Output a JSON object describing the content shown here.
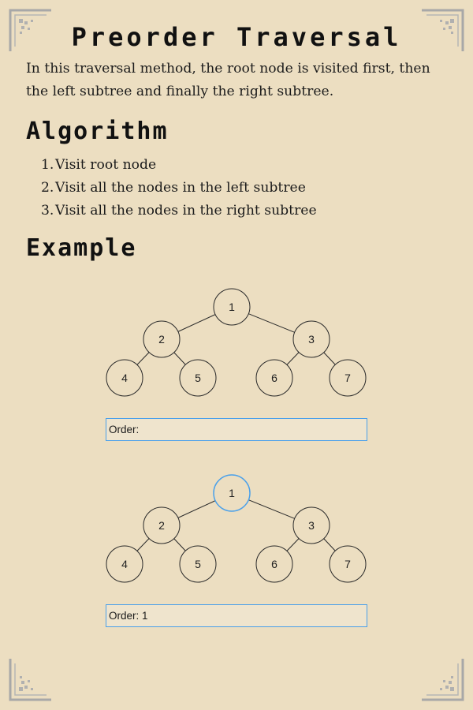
{
  "title": "Preorder Traversal",
  "intro": "In this traversal method, the root node is visited first, then the left subtree and finally the right subtree.",
  "algorithm": {
    "heading": "Algorithm",
    "steps": [
      {
        "num": "1.",
        "text": "Visit root node"
      },
      {
        "num": "2.",
        "text": "Visit all the nodes in the left subtree"
      },
      {
        "num": "3.",
        "text": "Visit all the nodes in the right subtree"
      }
    ]
  },
  "example": {
    "heading": "Example",
    "trees": [
      {
        "nodes": [
          "1",
          "2",
          "3",
          "4",
          "5",
          "6",
          "7"
        ],
        "highlighted": null,
        "order_label": "Order:",
        "order_value": ""
      },
      {
        "nodes": [
          "1",
          "2",
          "3",
          "4",
          "5",
          "6",
          "7"
        ],
        "highlighted": "1",
        "order_label": "Order:",
        "order_value": "1"
      }
    ]
  },
  "colors": {
    "background": "#ecdec1",
    "node_stroke": "#2a2a2a",
    "highlight": "#4aa0ea",
    "ornament": "#a8a8a8"
  }
}
